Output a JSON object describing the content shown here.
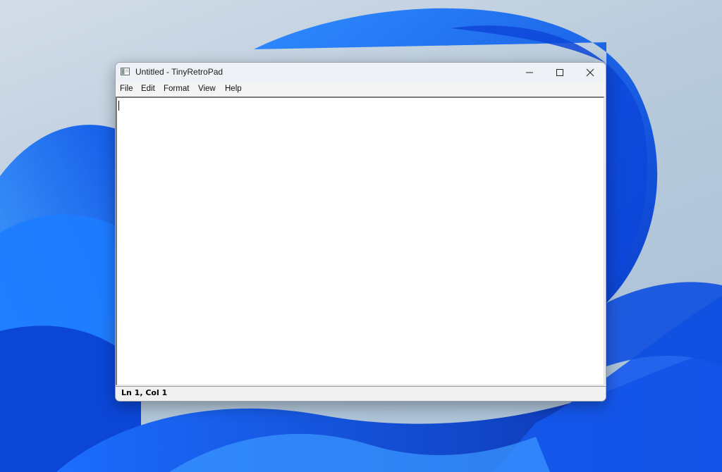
{
  "desktop": {
    "wallpaper": "windows-bloom-wallpaper",
    "accent_colors": [
      "#0a4fe0",
      "#1e7bff",
      "#4da3ff",
      "#a9c1d9"
    ]
  },
  "window": {
    "title": "Untitled - TinyRetroPad",
    "icon": "notepad-app-icon",
    "controls": {
      "minimize": "minimize-icon",
      "maximize": "maximize-icon",
      "close": "close-icon"
    }
  },
  "menu": {
    "items": [
      "File",
      "Edit",
      "Format",
      "View",
      "Help"
    ]
  },
  "editor": {
    "content": ""
  },
  "status": {
    "position": "Ln 1, Col 1"
  }
}
